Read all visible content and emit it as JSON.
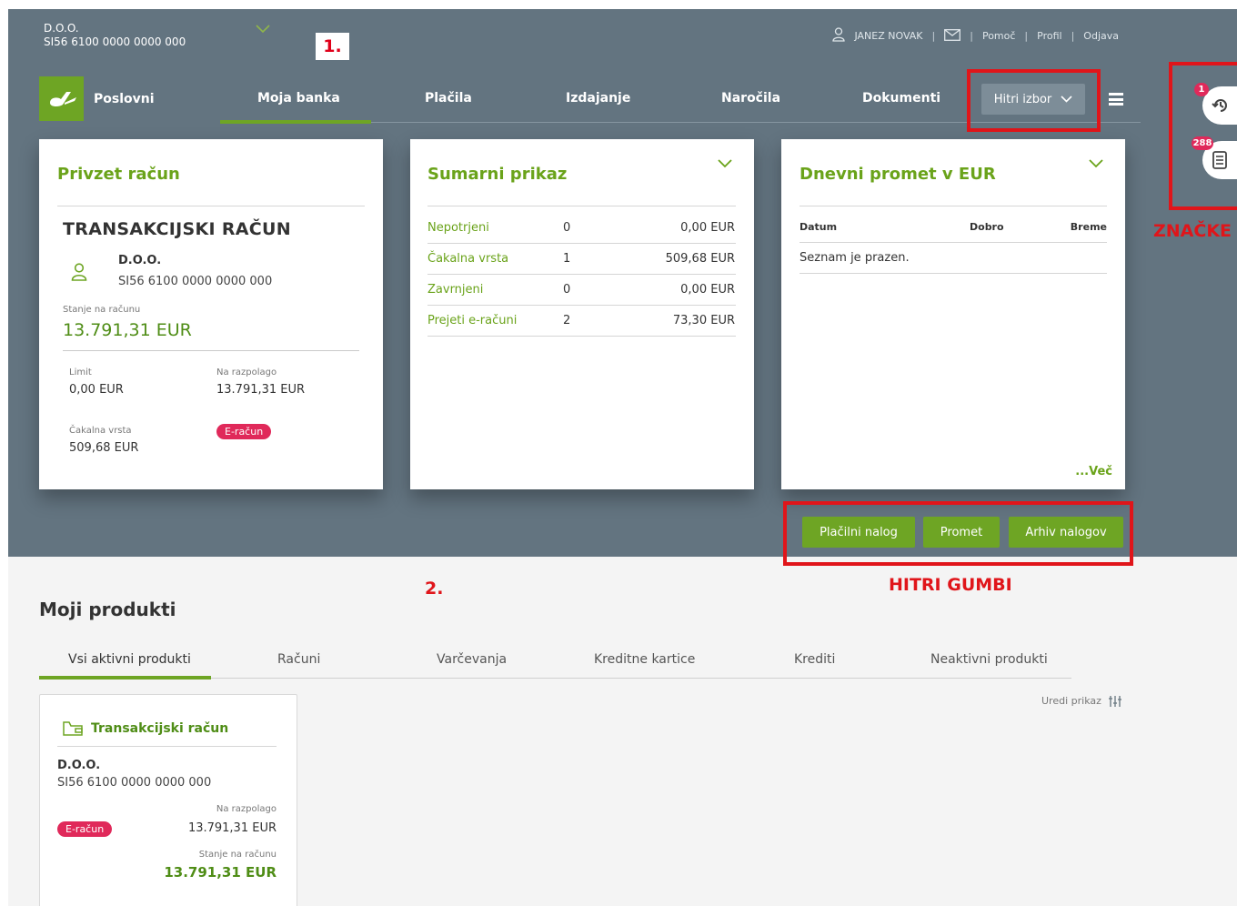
{
  "header": {
    "company_name": "D.O.O.",
    "company_iban": "SI56 6100 0000 0000 000",
    "annotation_1": "1.",
    "user_name": "JANEZ NOVAK",
    "links": {
      "help": "Pomoč",
      "profile": "Profil",
      "logout": "Odjava"
    },
    "brand": "Poslovni",
    "nav": [
      "Moja banka",
      "Plačila",
      "Izdajanje",
      "Naročila",
      "Dokumenti"
    ],
    "quick_select": "Hitri izbor"
  },
  "colors": {
    "accent": "#6ea524",
    "band": "#637480",
    "annotation": "#e0151a",
    "badge": "#e0295a"
  },
  "account_card": {
    "title": "Privzet račun",
    "type": "TRANSAKCIJSKI RAČUN",
    "name": "D.O.O.",
    "iban": "SI56 6100 0000 0000 000",
    "balance_label": "Stanje na računu",
    "balance": "13.791,31 EUR",
    "limit_label": "Limit",
    "limit": "0,00 EUR",
    "available_label": "Na razpolago",
    "available": "13.791,31 EUR",
    "queue_label": "Čakalna vrsta",
    "queue": "509,68 EUR",
    "ebadge": "E-račun"
  },
  "summary_card": {
    "title": "Sumarni prikaz",
    "rows": [
      {
        "label": "Nepotrjeni",
        "count": "0",
        "amount": "0,00 EUR"
      },
      {
        "label": "Čakalna vrsta",
        "count": "1",
        "amount": "509,68 EUR"
      },
      {
        "label": "Zavrnjeni",
        "count": "0",
        "amount": "0,00 EUR"
      },
      {
        "label": "Prejeti e-računi",
        "count": "2",
        "amount": "73,30 EUR"
      }
    ]
  },
  "daily_card": {
    "title": "Dnevni promet v EUR",
    "col_date": "Datum",
    "col_credit": "Dobro",
    "col_debit": "Breme",
    "empty": "Seznam je prazen.",
    "more": "...Več"
  },
  "quick_buttons": [
    "Plačilni nalog",
    "Promet",
    "Arhiv nalogov"
  ],
  "annotations": {
    "buttons": "HITRI GUMBI",
    "badges": "ZNAČKE",
    "num2": "2."
  },
  "side_badges": {
    "history_count": "1",
    "docs_count": "288"
  },
  "products": {
    "title": "Moji produkti",
    "tabs": [
      "Vsi aktivni produkti",
      "Računi",
      "Varčevanja",
      "Kreditne kartice",
      "Krediti",
      "Neaktivni produkti"
    ],
    "edit_view": "Uredi prikaz",
    "card": {
      "title": "Transakcijski račun",
      "name": "D.O.O.",
      "iban": "SI56 6100 0000 0000 000",
      "available_label": "Na razpolago",
      "available": "13.791,31 EUR",
      "balance_label": "Stanje na računu",
      "balance": "13.791,31 EUR",
      "ebadge": "E-račun"
    }
  }
}
